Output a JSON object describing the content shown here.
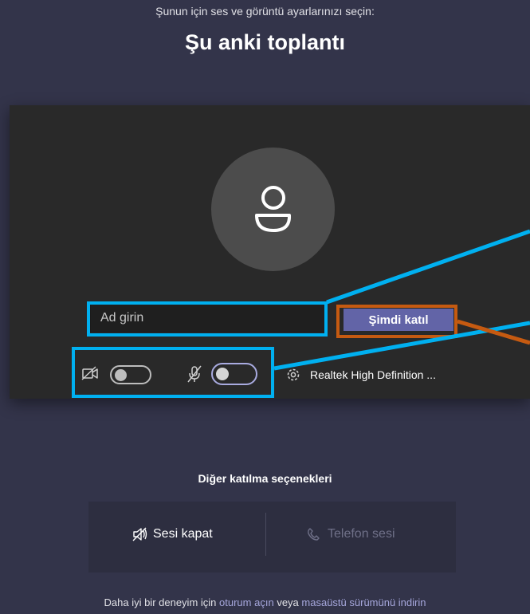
{
  "header": {
    "subtitle": "Şunun için ses ve görüntü ayarlarınızı seçin:",
    "title": "Şu anki toplantı"
  },
  "preview": {
    "name_input": {
      "placeholder": "Ad girin",
      "value": ""
    },
    "join_label": "Şimdi katıl",
    "camera_toggle": {
      "on": false
    },
    "mic_toggle": {
      "on": false
    },
    "device_label": "Realtek High Definition ..."
  },
  "other_options": {
    "title": "Diğer katılma seçenekleri",
    "audio_off_label": "Sesi kapat",
    "phone_audio_label": "Telefon sesi"
  },
  "footer": {
    "prefix": "Daha iyi bir deneyim için",
    "sign_in_link": "oturum açın",
    "middle": "veya",
    "download_link": "masaüstü sürümünü indirin"
  },
  "colors": {
    "background": "#33344a",
    "preview_bg": "#292929",
    "join_button": "#6264a7",
    "callout_blue": "#00b0f0",
    "callout_orange": "#c55a11",
    "link": "#a6a7dc"
  },
  "icons": [
    "avatar-person-icon",
    "camera-off-icon",
    "mic-off-icon",
    "gear-icon",
    "speaker-off-icon",
    "phone-icon"
  ]
}
